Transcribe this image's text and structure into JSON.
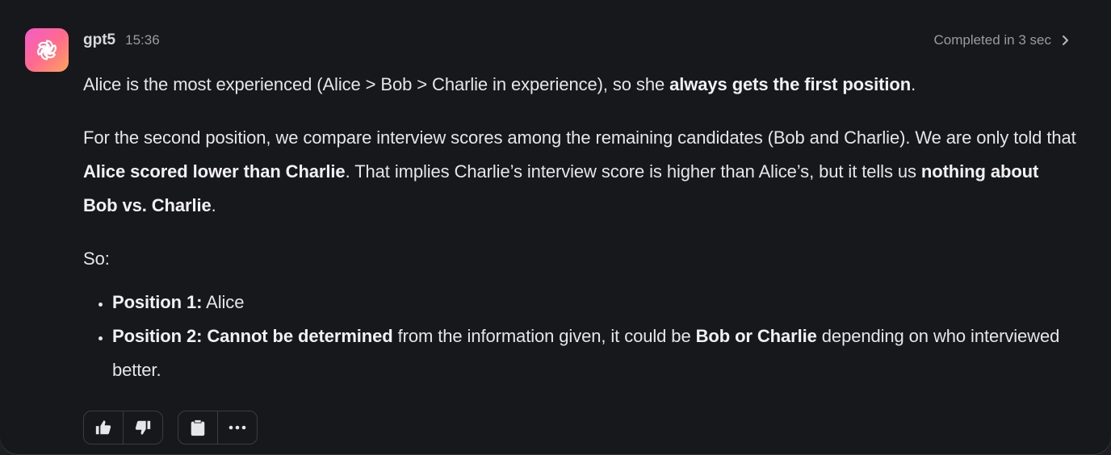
{
  "message": {
    "model_name": "gpt5",
    "time": "15:36",
    "status_text": "Completed in 3 sec",
    "avatar_icon": "openai-logo-icon",
    "avatar_gradient": [
      "#f35cc9",
      "#ffa45c"
    ]
  },
  "content": {
    "p1": {
      "text_1": "Alice is the most experienced (Alice > Bob > Charlie in experience), so she ",
      "bold_1": "always gets the first position",
      "text_2": "."
    },
    "p2": {
      "text_1": "For the second position, we compare interview scores among the remaining candidates (Bob and Charlie). We are only told that ",
      "bold_1": "Alice scored lower than Charlie",
      "text_2": ". That implies Charlie’s interview score is higher than Alice’s, but it tells us ",
      "bold_2": "nothing about Bob vs. Charlie",
      "text_3": "."
    },
    "p3": {
      "text": "So:"
    },
    "list": [
      {
        "bold": "Position 1:",
        "text": " Alice"
      },
      {
        "bold": "Position 2: Cannot be determined",
        "text_1": " from the information given, it could be ",
        "bold_2": "Bob or Charlie",
        "text_2": " depending on who interviewed better."
      }
    ]
  },
  "actions": {
    "icons": [
      "thumbs-up-icon",
      "thumbs-down-icon",
      "clipboard-icon",
      "more-icon"
    ]
  }
}
